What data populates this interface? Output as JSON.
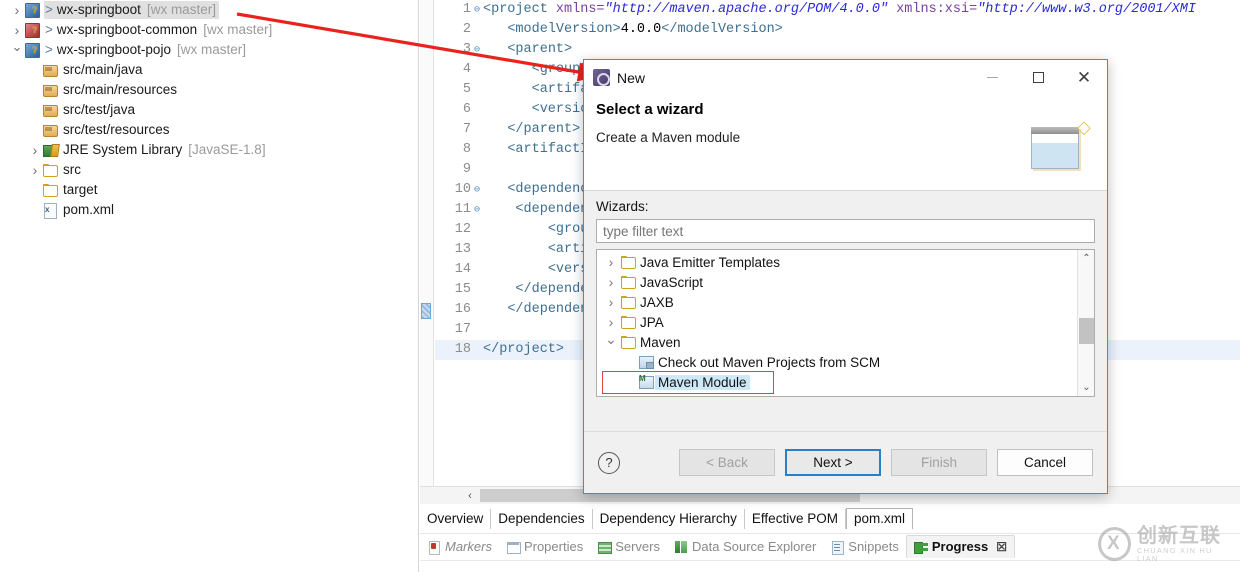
{
  "explorer": {
    "items": [
      {
        "indent": 0,
        "twisty": "closed",
        "icon": "proj",
        "prefix": ">",
        "label": "wx-springboot",
        "branch": "[wx master]",
        "selected": true
      },
      {
        "indent": 0,
        "twisty": "closed",
        "icon": "proj-red",
        "prefix": ">",
        "label": "wx-springboot-common",
        "branch": "[wx master]",
        "selected": false
      },
      {
        "indent": 0,
        "twisty": "open",
        "icon": "proj",
        "prefix": ">",
        "label": "wx-springboot-pojo",
        "branch": "[wx master]",
        "selected": false
      },
      {
        "indent": 1,
        "twisty": "none",
        "icon": "srcfolder",
        "prefix": "",
        "label": "src/main/java",
        "branch": "",
        "selected": false
      },
      {
        "indent": 1,
        "twisty": "none",
        "icon": "srcfolder",
        "prefix": "",
        "label": "src/main/resources",
        "branch": "",
        "selected": false
      },
      {
        "indent": 1,
        "twisty": "none",
        "icon": "srcfolder",
        "prefix": "",
        "label": "src/test/java",
        "branch": "",
        "selected": false
      },
      {
        "indent": 1,
        "twisty": "none",
        "icon": "srcfolder",
        "prefix": "",
        "label": "src/test/resources",
        "branch": "",
        "selected": false
      },
      {
        "indent": 1,
        "twisty": "closed",
        "icon": "jre",
        "prefix": "",
        "label": "JRE System Library",
        "branch": "[JavaSE-1.8]",
        "selected": false
      },
      {
        "indent": 1,
        "twisty": "closed",
        "icon": "folder",
        "prefix": "",
        "label": "src",
        "branch": "",
        "selected": false
      },
      {
        "indent": 1,
        "twisty": "none",
        "icon": "folder",
        "prefix": "",
        "label": "target",
        "branch": "",
        "selected": false
      },
      {
        "indent": 1,
        "twisty": "none",
        "icon": "xml",
        "prefix": "",
        "label": "pom.xml",
        "branch": "",
        "selected": false
      }
    ]
  },
  "editor": {
    "lines": [
      {
        "no": "1",
        "fold": "⊖",
        "html": "<span class=\"tag\">&lt;project</span> <span class=\"attr\">xmlns=</span><span class=\"aval\">\"http://maven.apache.org/POM/4.0.0\"</span> <span class=\"attr\">xmlns:xsi=</span><span class=\"aval\">\"http://www.w3.org/2001/XMI</span>"
      },
      {
        "no": "2",
        "fold": "",
        "html": "   <span class=\"tag\">&lt;modelVersion&gt;</span><span class=\"txt\">4.0.0</span><span class=\"tag\">&lt;/modelVersion&gt;</span>"
      },
      {
        "no": "3",
        "fold": "⊖",
        "html": "   <span class=\"tag\">&lt;parent&gt;</span>"
      },
      {
        "no": "4",
        "fold": "",
        "html": "      <span class=\"tag\">&lt;groupId&gt;</span>"
      },
      {
        "no": "5",
        "fold": "",
        "html": "      <span class=\"tag\">&lt;artifact</span>"
      },
      {
        "no": "6",
        "fold": "",
        "html": "      <span class=\"tag\">&lt;version&gt;</span>"
      },
      {
        "no": "7",
        "fold": "",
        "html": "   <span class=\"tag\">&lt;/parent&gt;</span>"
      },
      {
        "no": "8",
        "fold": "",
        "html": "   <span class=\"tag\">&lt;artifactId</span>"
      },
      {
        "no": "9",
        "fold": "",
        "html": ""
      },
      {
        "no": "10",
        "fold": "⊖",
        "html": "   <span class=\"tag\">&lt;dependenci</span>"
      },
      {
        "no": "11",
        "fold": "⊖",
        "html": "    <span class=\"tag\">&lt;dependen</span>"
      },
      {
        "no": "12",
        "fold": "",
        "html": "        <span class=\"tag\">&lt;grou</span>"
      },
      {
        "no": "13",
        "fold": "",
        "html": "        <span class=\"tag\">&lt;arti</span>"
      },
      {
        "no": "14",
        "fold": "",
        "html": "        <span class=\"tag\">&lt;vers</span>"
      },
      {
        "no": "15",
        "fold": "",
        "html": "    <span class=\"tag\">&lt;/depende</span>"
      },
      {
        "no": "16",
        "fold": "",
        "html": "   <span class=\"tag\">&lt;/dependenc</span>"
      },
      {
        "no": "17",
        "fold": "",
        "html": ""
      },
      {
        "no": "18",
        "fold": "",
        "html": "<span class=\"tag\">&lt;/project&gt;</span>",
        "highlight": true
      }
    ],
    "page_tabs": [
      {
        "label": "Overview",
        "active": false
      },
      {
        "label": "Dependencies",
        "active": false
      },
      {
        "label": "Dependency Hierarchy",
        "active": false
      },
      {
        "label": "Effective POM",
        "active": false
      },
      {
        "label": "pom.xml",
        "active": true
      }
    ]
  },
  "view_tabs": [
    {
      "label": "Markers",
      "icon": "markers",
      "selected": false,
      "italic": true
    },
    {
      "label": "Properties",
      "icon": "props",
      "selected": false,
      "italic": false
    },
    {
      "label": "Servers",
      "icon": "servers",
      "selected": false,
      "italic": false
    },
    {
      "label": "Data Source Explorer",
      "icon": "ds",
      "selected": false,
      "italic": false
    },
    {
      "label": "Snippets",
      "icon": "snip",
      "selected": false,
      "italic": false
    },
    {
      "label": "Progress",
      "icon": "progress",
      "selected": true,
      "italic": false,
      "close": "☒"
    }
  ],
  "dialog": {
    "title": "New",
    "minimize_label": "–",
    "maximize_label": "",
    "close_label": "✕",
    "head_title": "Select a wizard",
    "head_subtitle": "Create a Maven module",
    "wizards_label": "Wizards:",
    "filter_placeholder": "type filter text",
    "filter_value": "",
    "tree": [
      {
        "indent": 0,
        "twisty": "closed",
        "icon": "folder",
        "label": "Java Emitter Templates",
        "selected": false
      },
      {
        "indent": 0,
        "twisty": "closed",
        "icon": "folder",
        "label": "JavaScript",
        "selected": false
      },
      {
        "indent": 0,
        "twisty": "closed",
        "icon": "folder",
        "label": "JAXB",
        "selected": false
      },
      {
        "indent": 0,
        "twisty": "closed",
        "icon": "folder",
        "label": "JPA",
        "selected": false
      },
      {
        "indent": 0,
        "twisty": "open",
        "icon": "folder",
        "label": "Maven",
        "selected": false
      },
      {
        "indent": 1,
        "twisty": "none",
        "icon": "scm",
        "label": "Check out Maven Projects from SCM",
        "selected": false
      },
      {
        "indent": 1,
        "twisty": "none",
        "icon": "module",
        "label": "Maven Module",
        "selected": true
      }
    ],
    "scroll_up": "⌃",
    "scroll_down": "⌄",
    "help_label": "?",
    "buttons": [
      {
        "label": "< Back",
        "state": "disabled"
      },
      {
        "label": "Next >",
        "state": "default"
      },
      {
        "label": "Finish",
        "state": "disabled"
      },
      {
        "label": "Cancel",
        "state": "plain"
      }
    ]
  },
  "watermark": {
    "cn": "创新互联",
    "en": "CHUANG XIN HU LIAN"
  },
  "annotation": {
    "arrow_color": "#e8231e"
  }
}
